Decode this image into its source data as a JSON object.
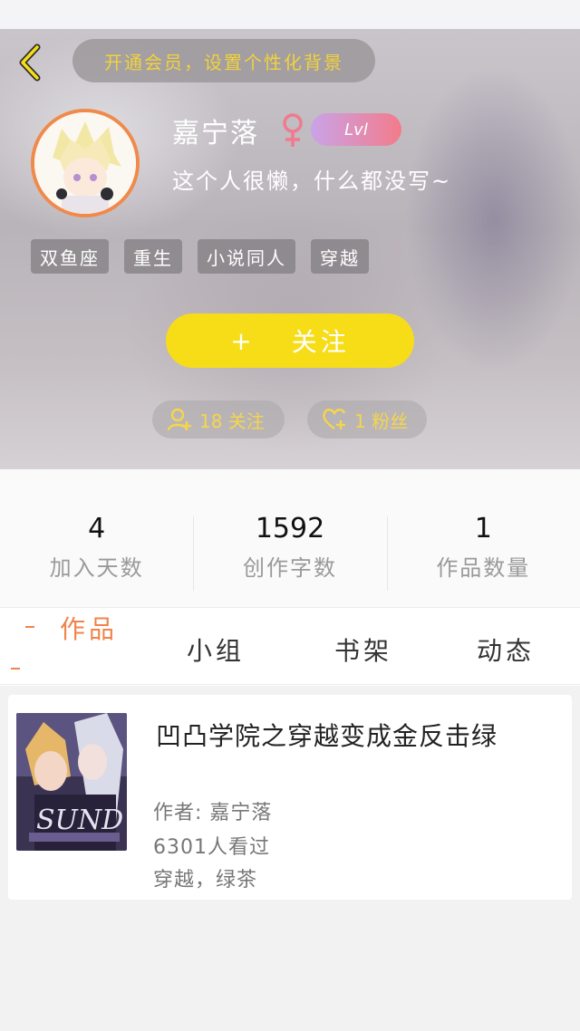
{
  "header": {
    "vip_banner": "开通会员，设置个性化背景",
    "username": "嘉宁落",
    "level": "Lvl",
    "signature": "这个人很懒，什么都没写~",
    "tags": [
      "双鱼座",
      "重生",
      "小说同人",
      "穿越"
    ],
    "follow_plus": "+",
    "follow_label": "关注",
    "following_text": "18 关注",
    "fans_text": "1 粉丝"
  },
  "stats": [
    {
      "value": "4",
      "label": "加入天数"
    },
    {
      "value": "1592",
      "label": "创作字数"
    },
    {
      "value": "1",
      "label": "作品数量"
    }
  ],
  "tabs": {
    "works": "作品",
    "groups": "小组",
    "shelf": "书架",
    "feed": "动态"
  },
  "works": [
    {
      "title": "凹凸学院之穿越变成金反击绿",
      "author": "作者: 嘉宁落",
      "views": "6301人看过",
      "tags": "穿越，绿茶"
    }
  ],
  "colors": {
    "accent_orange": "#f0844a",
    "follow_yellow": "#f7dc18",
    "banner_text": "#f3d23a"
  }
}
